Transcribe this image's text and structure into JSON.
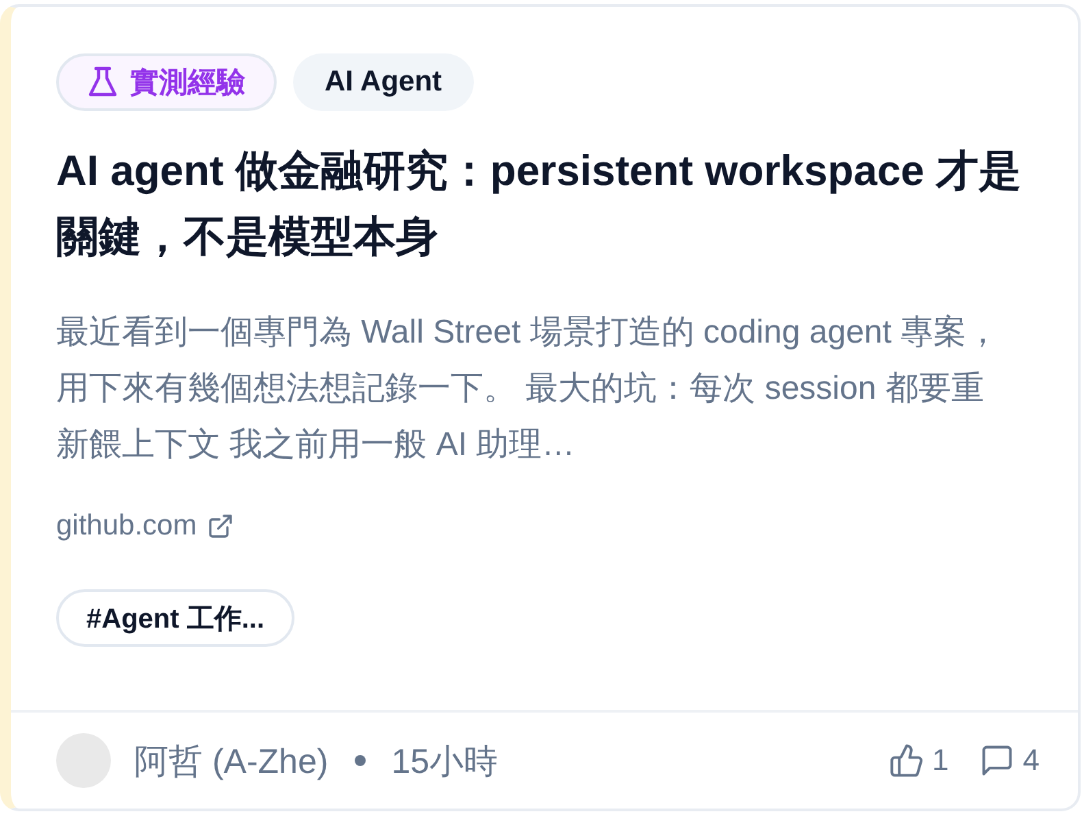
{
  "post": {
    "badges": [
      {
        "kind": "category",
        "label": "實測經驗"
      },
      {
        "kind": "topic",
        "label": "AI Agent"
      }
    ],
    "title": "AI agent 做金融研究：persistent workspace 才是關鍵，不是模型本身",
    "excerpt": "最近看到一個專門為 Wall Street 場景打造的 coding agent 專案，用下來有幾個想法想記錄一下。 最大的坑：每次 session 都要重新餵上下文 我之前用一般 AI 助理…",
    "source": "github.com",
    "tags": [
      "#Agent 工作..."
    ],
    "author": "阿哲 (A-Zhe)",
    "time": "15小時",
    "likes": "1",
    "comments": "4"
  }
}
